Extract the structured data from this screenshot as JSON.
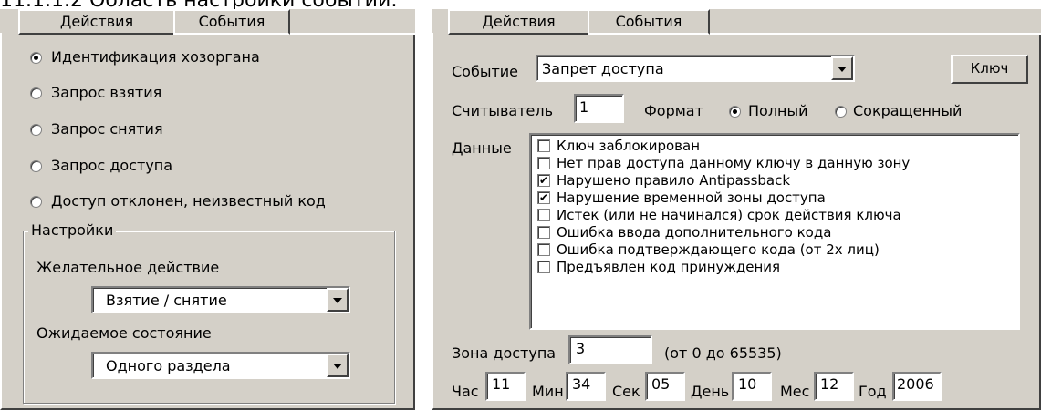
{
  "caption": "11.1.1.2 Область настройки событий:",
  "left": {
    "tabs": [
      "Действия",
      "События"
    ],
    "radios": [
      {
        "label": "Идентификация хозоргана",
        "checked": true
      },
      {
        "label": "Запрос взятия",
        "checked": false
      },
      {
        "label": "Запрос снятия",
        "checked": false
      },
      {
        "label": "Запрос доступа",
        "checked": false
      },
      {
        "label": "Доступ отклонен, неизвестный код",
        "checked": false
      }
    ],
    "settings": {
      "title": "Настройки",
      "desired_label": "Желательное действие",
      "desired_value": "Взятие / снятие",
      "expected_label": "Ожидаемое состояние",
      "expected_value": "Одного раздела"
    }
  },
  "right": {
    "tabs": [
      "Действия",
      "События"
    ],
    "event_label": "Событие",
    "event_value": "Запрет доступа",
    "key_button": "Ключ",
    "reader_label": "Считыватель",
    "reader_value": "1",
    "format_label": "Формат",
    "format_full": "Полный",
    "format_short": "Сокращенный",
    "data_label": "Данные",
    "data_items": [
      {
        "label": "Ключ заблокирован",
        "checked": false
      },
      {
        "label": "Нет прав доступа данному ключу в данную зону",
        "checked": false
      },
      {
        "label": "Нарушено правило Antipassback",
        "checked": true
      },
      {
        "label": "Нарушение временной зоны доступа",
        "checked": true
      },
      {
        "label": "Истек (или не начинался) срок действия ключа",
        "checked": false
      },
      {
        "label": "Ошибка ввода дополнительного кода",
        "checked": false
      },
      {
        "label": "Ошибка подтверждающего кода (от 2х лиц)",
        "checked": false
      },
      {
        "label": "Предъявлен код принуждения",
        "checked": false
      }
    ],
    "zone_label": "Зона доступа",
    "zone_value": "3",
    "zone_range": "(от 0 до 65535)",
    "time": {
      "hour_label": "Час",
      "hour": "11",
      "min_label": "Мин",
      "min": "34",
      "sec_label": "Сек",
      "sec": "05",
      "day_label": "День",
      "day": "10",
      "month_label": "Мес",
      "month": "12",
      "year_label": "Год",
      "year": "2006"
    }
  }
}
